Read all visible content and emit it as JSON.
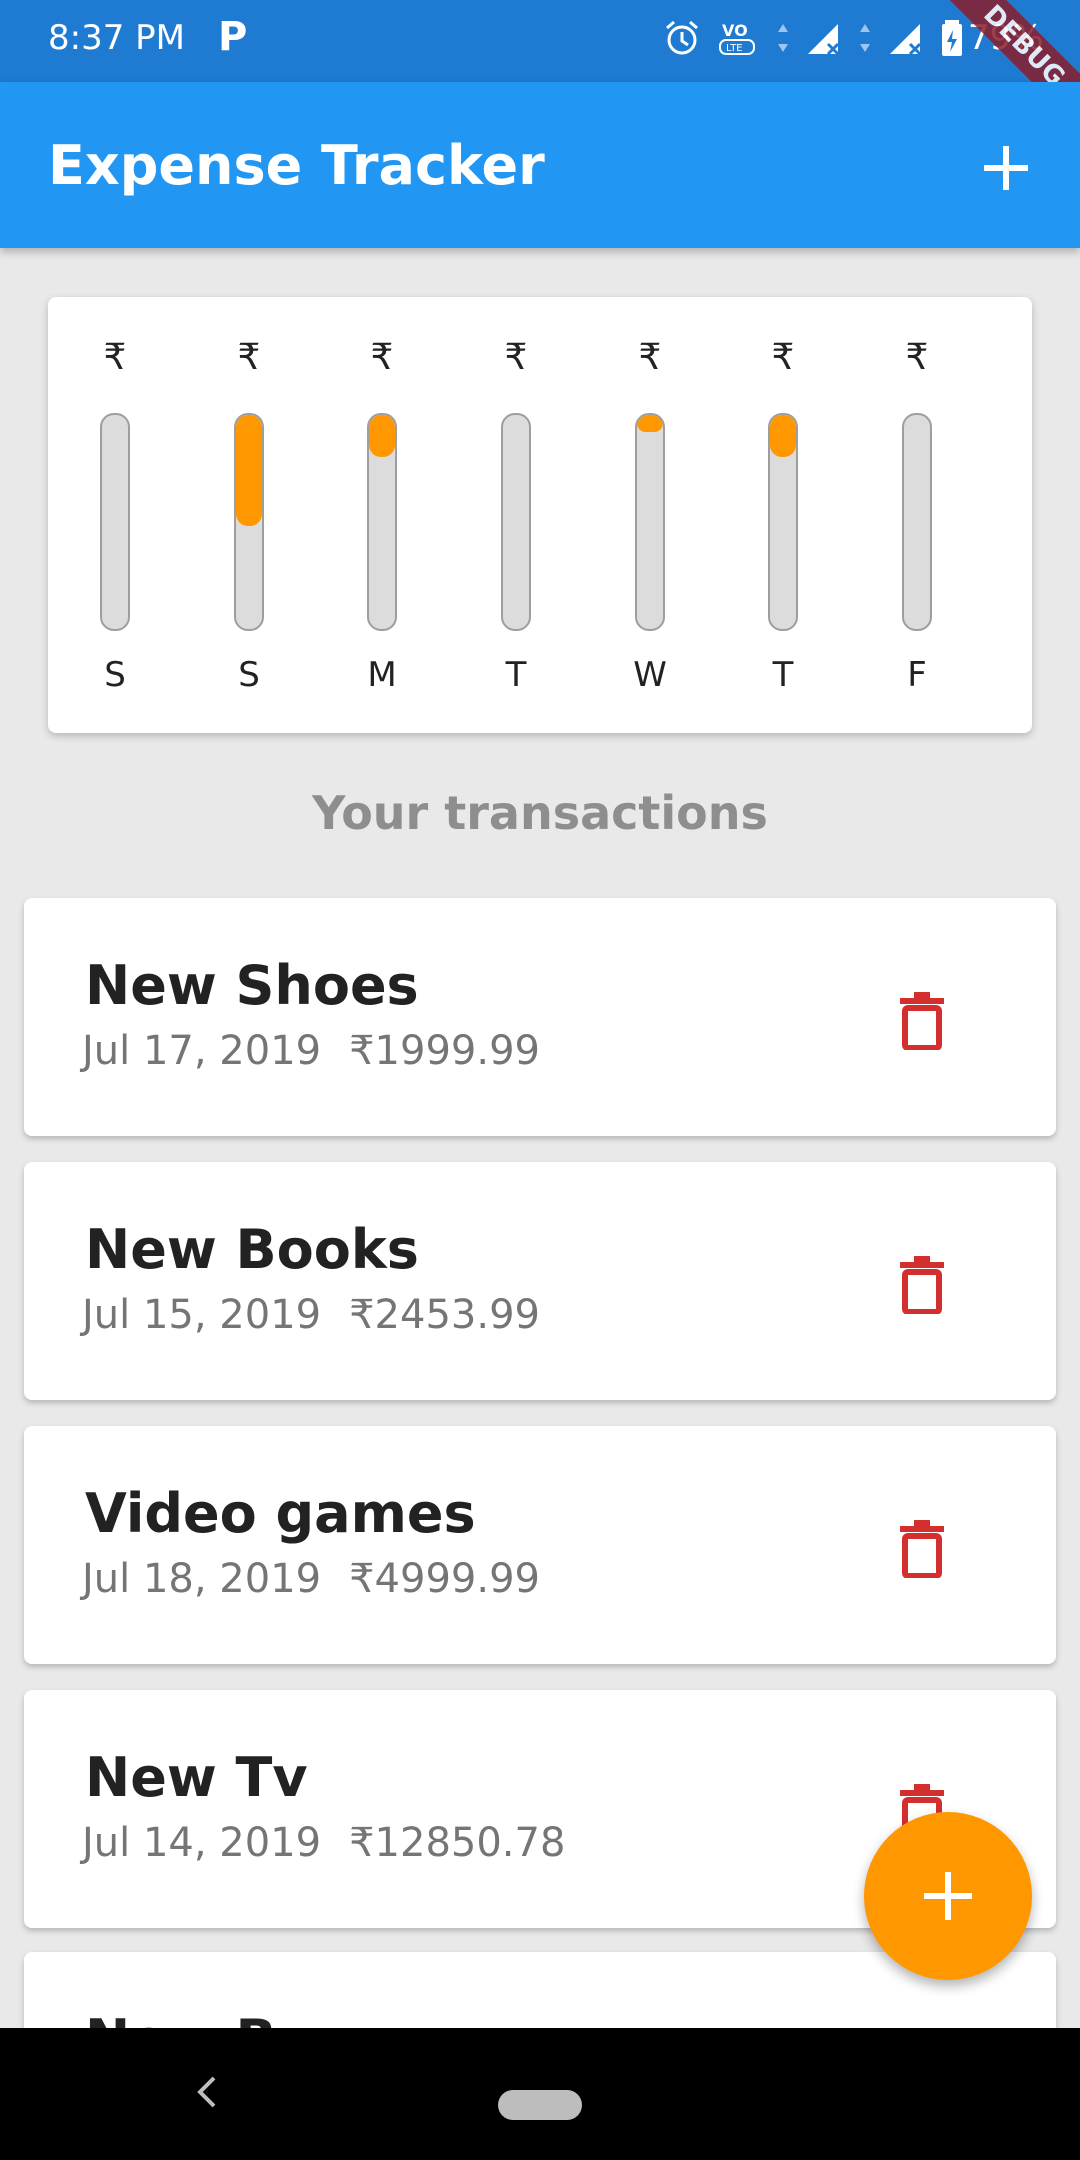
{
  "status_bar": {
    "time": "8:37 PM",
    "notification_app": "P",
    "battery": "79%",
    "icons": [
      "alarm-icon",
      "volte-icon",
      "signal-icon",
      "signal-icon",
      "battery-icon"
    ]
  },
  "debug_banner": "DEBUG",
  "app_bar": {
    "title": "Expense Tracker",
    "add_icon": "plus-icon"
  },
  "chart": {
    "accent_color": "#ff9800",
    "bars": [
      {
        "day": "S",
        "amount": "₹",
        "fraction": 0.0
      },
      {
        "day": "S",
        "amount": "₹",
        "fraction": 0.53
      },
      {
        "day": "M",
        "amount": "₹",
        "fraction": 0.2
      },
      {
        "day": "T",
        "amount": "₹",
        "fraction": 0.0
      },
      {
        "day": "W",
        "amount": "₹",
        "fraction": 0.08
      },
      {
        "day": "T",
        "amount": "₹",
        "fraction": 0.2
      },
      {
        "day": "F",
        "amount": "₹",
        "fraction": 0.0
      }
    ]
  },
  "section_title": "Your transactions",
  "transactions": [
    {
      "title": "New Shoes",
      "date": "Jul 17, 2019",
      "amount": "₹1999.99"
    },
    {
      "title": "New Books",
      "date": "Jul 15, 2019",
      "amount": "₹2453.99"
    },
    {
      "title": "Video games",
      "date": "Jul 18, 2019",
      "amount": "₹4999.99"
    },
    {
      "title": "New Tv",
      "date": "Jul 14, 2019",
      "amount": "₹12850.78"
    },
    {
      "title": "New B"
    }
  ],
  "delete_color": "#d32f2f",
  "fab_icon": "plus-icon"
}
